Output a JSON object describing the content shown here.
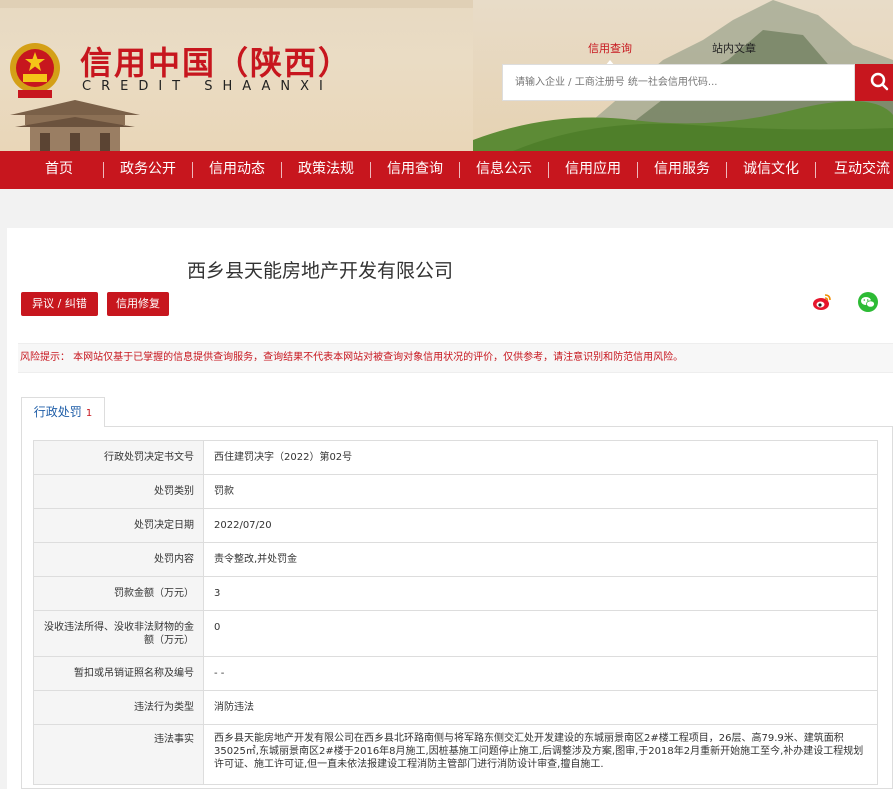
{
  "header": {
    "logo_cn": "信用中国（陕西）",
    "logo_en": "CREDIT   SHAANXI",
    "search_tabs": [
      "信用查询",
      "站内文章"
    ],
    "search_placeholder": "请输入企业 / 工商注册号 统一社会信用代码..."
  },
  "nav": {
    "items": [
      "首页",
      "政务公开",
      "信用动态",
      "政策法规",
      "信用查询",
      "信息公示",
      "信用应用",
      "信用服务",
      "诚信文化",
      "互动交流"
    ]
  },
  "company": {
    "name": "西乡县天能房地产开发有限公司",
    "buttons": [
      "异议 / 纠错",
      "信用修复"
    ],
    "share_icons": [
      "weibo-icon",
      "wechat-icon"
    ]
  },
  "risk_notice": "风险提示： 本网站仅基于已掌握的信息提供查询服务，查询结果不代表本网站对被查询对象信用状况的评价，仅供参考，请注意识别和防范信用风险。",
  "tab": {
    "label": "行政处罚",
    "count": "1"
  },
  "record": [
    {
      "key": "行政处罚决定书文号",
      "value": "西住建罚决字（2022）第02号"
    },
    {
      "key": "处罚类别",
      "value": "罚款"
    },
    {
      "key": "处罚决定日期",
      "value": "2022/07/20"
    },
    {
      "key": "处罚内容",
      "value": "责令整改,并处罚金"
    },
    {
      "key": "罚款金额（万元）",
      "value": "3"
    },
    {
      "key": "没收违法所得、没收非法财物的金额（万元）",
      "value": "0"
    },
    {
      "key": "暂扣或吊销证照名称及编号",
      "value": "- -"
    },
    {
      "key": "违法行为类型",
      "value": "消防违法"
    },
    {
      "key": "违法事实",
      "value": "西乡县天能房地产开发有限公司在西乡县北环路南侧与将军路东侧交汇处开发建设的东城丽景南区2#楼工程项目，26层、高79.9米、建筑面积35025㎡,东城丽景南区2#楼于2016年8月施工,因桩基施工问题停止施工,后调整涉及方案,图审,于2018年2月重新开始施工至今,补办建设工程规划许可证、施工许可证,但一直未依法报建设工程消防主管部门进行消防设计审查,擅自施工."
    }
  ],
  "colors": {
    "brand_red": "#c7161e",
    "tab_blue": "#1f5ea8"
  }
}
